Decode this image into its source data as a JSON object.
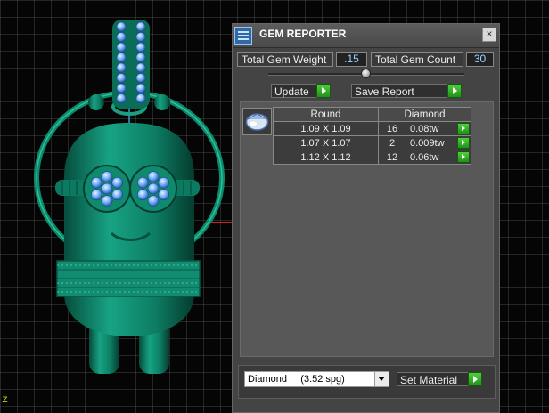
{
  "viewport": {
    "axis_label": "z",
    "colors": {
      "model": "#0f8a6c",
      "gem": "#7ab4ff",
      "axis": "#d02020",
      "grid": "#777777"
    }
  },
  "panel": {
    "icon": "report-grid-icon",
    "title": "GEM REPORTER",
    "close_label": "×",
    "total_weight_label": "Total Gem Weight",
    "total_weight_value": ".15",
    "total_count_label": "Total Gem Count",
    "total_count_value": "30",
    "update_label": "Update",
    "save_report_label": "Save Report",
    "slider_value": 0.47,
    "table": {
      "shape_icon": "round-gem-icon",
      "header_shape": "Round",
      "header_material": "Diamond",
      "rows": [
        {
          "size": "1.09 X 1.09",
          "count": "16",
          "weight": "0.08tw"
        },
        {
          "size": "1.07 X 1.07",
          "count": "2",
          "weight": "0.009tw"
        },
        {
          "size": "1.12 X 1.12",
          "count": "12",
          "weight": "0.06tw"
        }
      ]
    },
    "material_select": {
      "value": "Diamond     (3.52 spg)"
    },
    "set_material_label": "Set Material"
  }
}
